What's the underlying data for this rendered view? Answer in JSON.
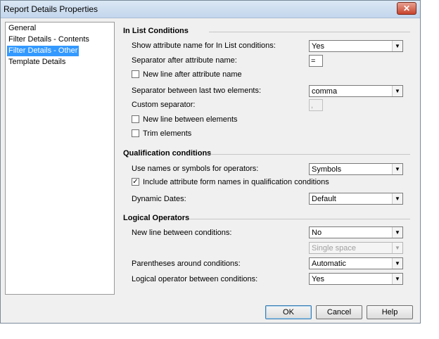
{
  "window": {
    "title": "Report Details Properties",
    "close_glyph": "✕"
  },
  "nav": {
    "items": [
      {
        "label": "General"
      },
      {
        "label": "Filter Details - Contents"
      },
      {
        "label": "Filter Details - Other",
        "selected": true
      },
      {
        "label": "Template Details"
      }
    ]
  },
  "in_list": {
    "heading": "In List Conditions",
    "show_attr_label": "Show attribute name for In List conditions:",
    "show_attr_value": "Yes",
    "sep_after_label": "Separator after attribute name:",
    "sep_after_value": "=",
    "new_line_after_label": "New line after attribute name",
    "new_line_after_checked": false,
    "sep_last_two_label": "Separator between last two elements:",
    "sep_last_two_value": "comma",
    "custom_sep_label": "Custom separator:",
    "custom_sep_value": ",",
    "new_line_between_label": "New line between elements",
    "new_line_between_checked": false,
    "trim_label": "Trim elements",
    "trim_checked": false
  },
  "qualification": {
    "heading": "Qualification conditions",
    "use_names_label": "Use names or symbols for operators:",
    "use_names_value": "Symbols",
    "include_form_label": "Include attribute form names in qualification conditions",
    "include_form_checked": true,
    "dynamic_dates_label": "Dynamic Dates:",
    "dynamic_dates_value": "Default"
  },
  "logical": {
    "heading": "Logical Operators",
    "new_line_cond_label": "New line between conditions:",
    "new_line_cond_value": "No",
    "spacing_value": "Single space",
    "parentheses_label": "Parentheses around conditions:",
    "parentheses_value": "Automatic",
    "operator_label": "Logical operator between conditions:",
    "operator_value": "Yes"
  },
  "buttons": {
    "ok": "OK",
    "cancel": "Cancel",
    "help": "Help"
  },
  "glyphs": {
    "dropdown_arrow": "▼",
    "check_mark": "✓"
  },
  "colors": {
    "selection": "#3399ff",
    "title_bar": "#c3d6ec",
    "close": "#c7432c"
  }
}
